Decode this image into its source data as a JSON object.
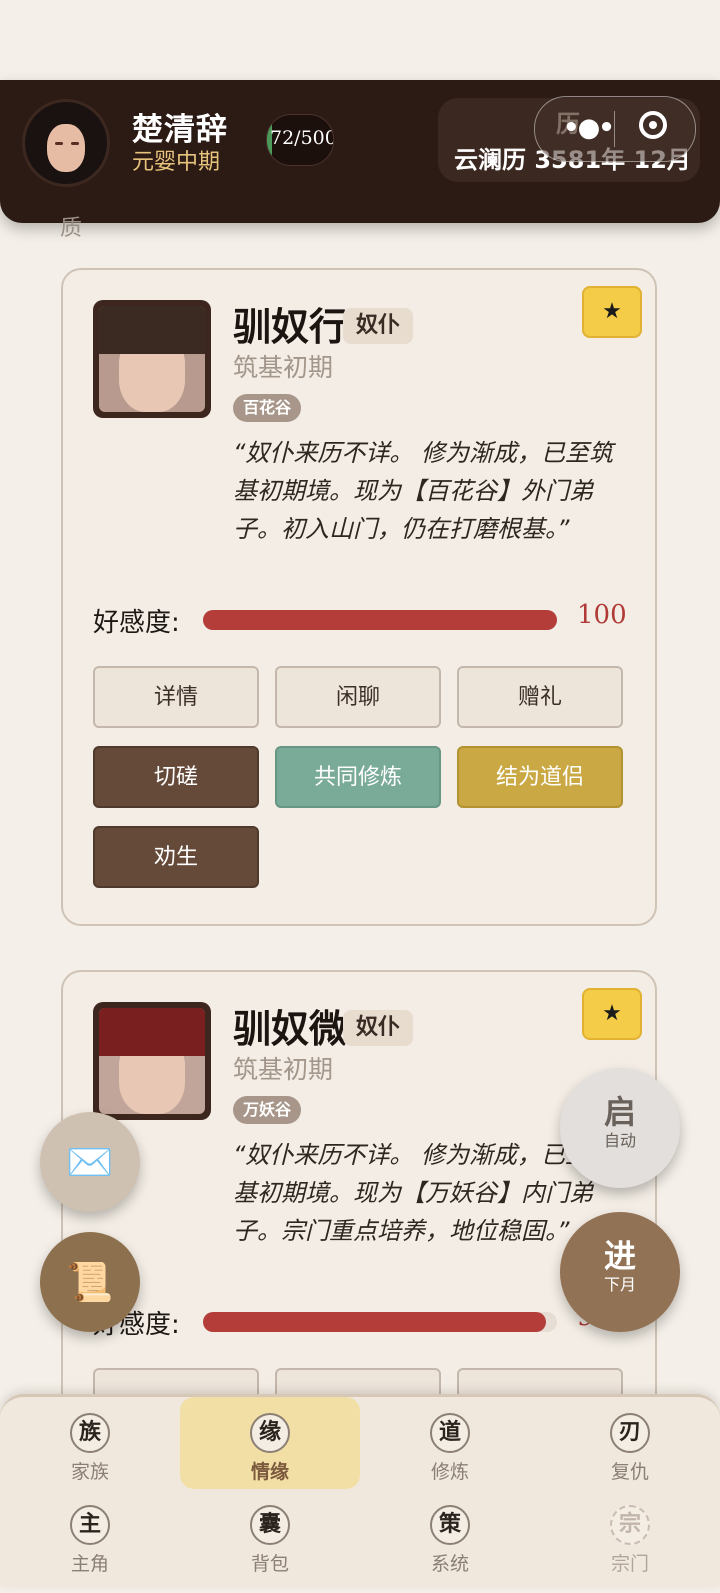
{
  "header": {
    "player_name": "楚清辞",
    "player_realm": "元婴中期",
    "exp_text": "72/500",
    "calendar_text": "云澜历 3581年 12月",
    "calendar_peek": "历"
  },
  "hidden_label": "质",
  "cards": [
    {
      "name": "驯奴行",
      "role": "奴仆",
      "realm": "筑基初期",
      "sect": "百花谷",
      "star": "★",
      "description": "“奴仆来历不详。 修为渐成，已至筑基初期境。现为【百花谷】外门弟子。初入山门，仍在打磨根基。”",
      "affection_label": "好感度:",
      "affection_value": "100",
      "affection_percent": 100,
      "hair_color": "#3a2a22",
      "actions": [
        {
          "label": "详情",
          "style": "light"
        },
        {
          "label": "闲聊",
          "style": "light"
        },
        {
          "label": "赠礼",
          "style": "light"
        },
        {
          "label": "切磋",
          "style": "dark"
        },
        {
          "label": "共同修炼",
          "style": "green"
        },
        {
          "label": "结为道侣",
          "style": "gold"
        },
        {
          "label": "劝生",
          "style": "dark"
        }
      ]
    },
    {
      "name": "驯奴微",
      "role": "奴仆",
      "realm": "筑基初期",
      "sect": "万妖谷",
      "star": "★",
      "description": "“奴仆来历不详。 修为渐成，已至筑基初期境。现为【万妖谷】内门弟子。宗门重点培养，地位稳固。”",
      "affection_label": "好感度:",
      "affection_value": "97",
      "affection_percent": 97,
      "hair_color": "#7a1f1f"
    }
  ],
  "floating": {
    "mail_icon": "✉️",
    "scroll_icon": "📜",
    "auto_big": "启",
    "auto_small": "自动",
    "next_big": "进",
    "next_small": "下月"
  },
  "nav": [
    {
      "glyph": "族",
      "label": "家族"
    },
    {
      "glyph": "缘",
      "label": "情缘"
    },
    {
      "glyph": "道",
      "label": "修炼"
    },
    {
      "glyph": "刃",
      "label": "复仇"
    },
    {
      "glyph": "主",
      "label": "主角"
    },
    {
      "glyph": "囊",
      "label": "背包"
    },
    {
      "glyph": "策",
      "label": "系统"
    },
    {
      "glyph": "宗",
      "label": "宗门"
    }
  ]
}
